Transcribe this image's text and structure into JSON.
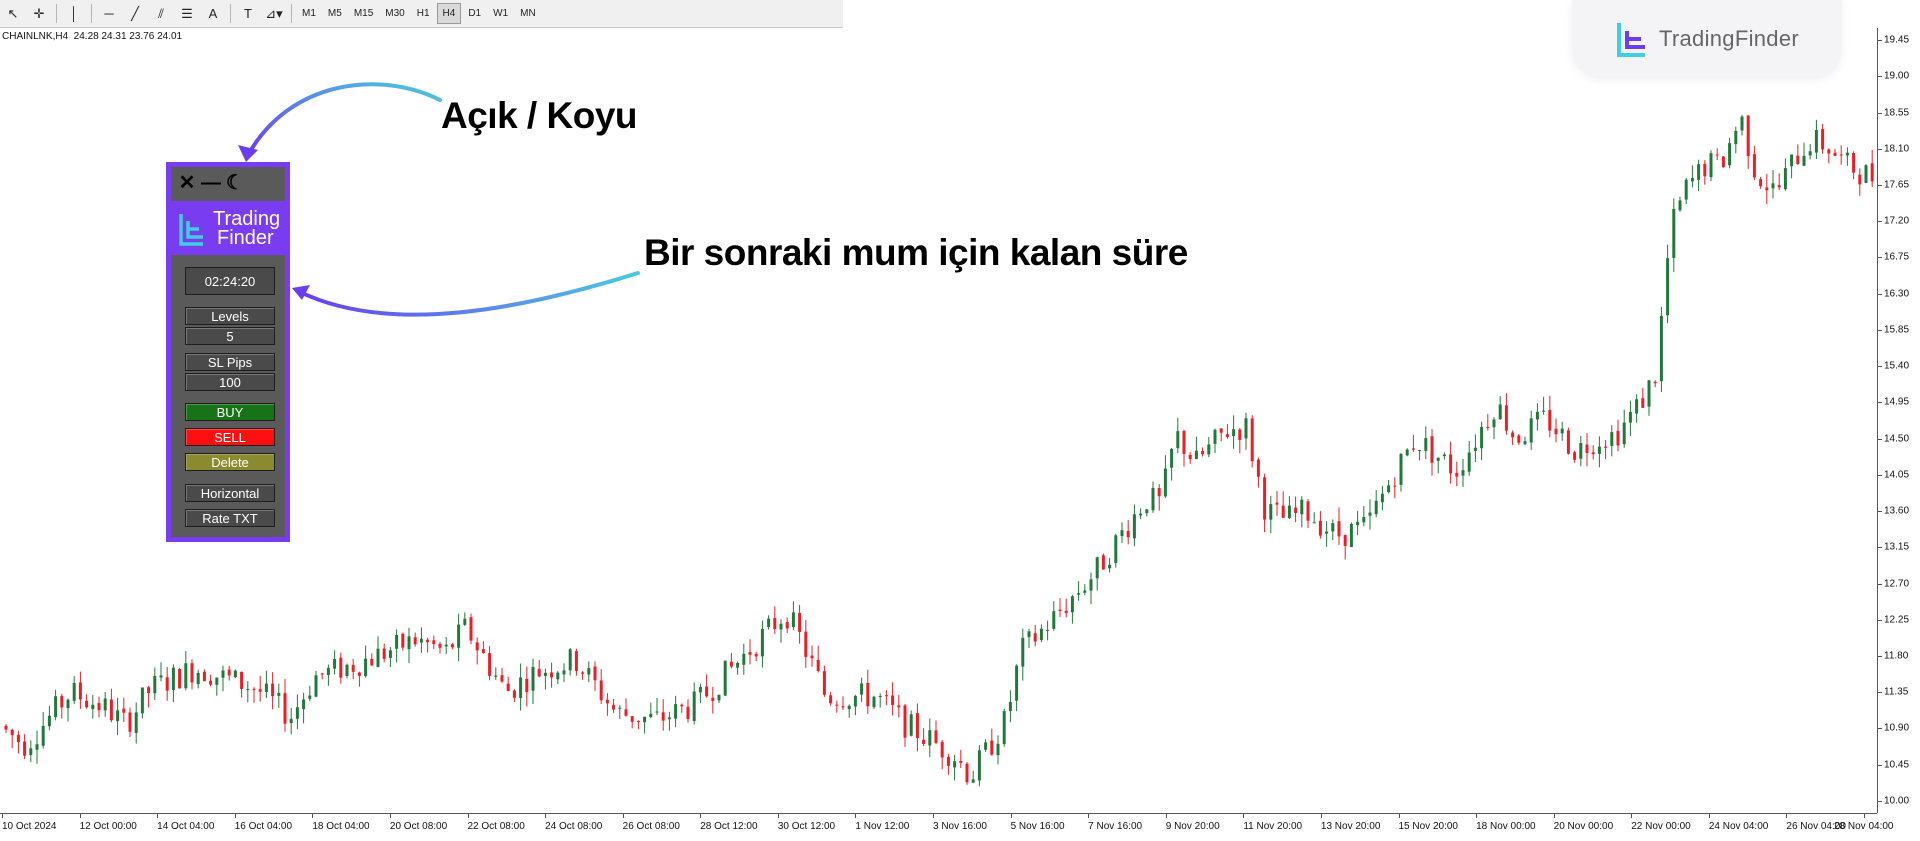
{
  "toolbar": {
    "tools": [
      {
        "name": "cursor-icon",
        "glyph": "↖"
      },
      {
        "name": "crosshair-icon",
        "glyph": "✛"
      },
      {
        "name": "vertical-line-icon",
        "glyph": "│"
      },
      {
        "name": "horizontal-line-icon",
        "glyph": "─"
      },
      {
        "name": "trendline-icon",
        "glyph": "╱"
      },
      {
        "name": "channel-icon",
        "glyph": "⫽"
      },
      {
        "name": "fibonacci-icon",
        "glyph": "☰"
      },
      {
        "name": "text-icon",
        "glyph": "A"
      },
      {
        "name": "text-label-icon",
        "glyph": "T"
      },
      {
        "name": "shapes-icon",
        "glyph": "⊿▾"
      }
    ],
    "timeframes": [
      "M1",
      "M5",
      "M15",
      "M30",
      "H1",
      "H4",
      "D1",
      "W1",
      "MN"
    ],
    "active_timeframe": "H4"
  },
  "symbol_info": "CHAINLNK,H4  24.28 24.31 23.76 24.01",
  "logo": {
    "text": "TradingFinder"
  },
  "panel": {
    "logo_line1": "Trading",
    "logo_line2": "Finder",
    "timer": "02:24:20",
    "levels_label": "Levels",
    "levels_value": "5",
    "sl_label": "SL Pips",
    "sl_value": "100",
    "buy_label": "BUY",
    "sell_label": "SELL",
    "delete_label": "Delete",
    "horizontal_label": "Horizontal",
    "rate_label": "Rate TXT"
  },
  "annotations": {
    "light_dark": "Açık / Koyu",
    "remaining_time": "Bir sonraki mum için kalan süre"
  },
  "colors": {
    "bull": "#1f7a3a",
    "bear": "#ee1c24",
    "panel_border": "#7a3cf0",
    "arrow_start": "#4cc9e0",
    "arrow_end": "#6a3df0"
  },
  "chart_data": {
    "type": "candlestick",
    "timeframe": "H4",
    "price_range": [
      9.85,
      19.6
    ],
    "price_ticks": [
      "19.45",
      "19.00",
      "18.55",
      "18.10",
      "17.65",
      "17.20",
      "16.75",
      "16.30",
      "15.85",
      "15.40",
      "14.95",
      "14.50",
      "14.05",
      "13.60",
      "13.15",
      "12.70",
      "12.25",
      "11.80",
      "11.35",
      "10.90",
      "10.45",
      "10.00"
    ],
    "time_labels": [
      "10 Oct 2024",
      "12 Oct 00:00",
      "14 Oct 04:00",
      "16 Oct 04:00",
      "18 Oct 04:00",
      "20 Oct 08:00",
      "22 Oct 08:00",
      "24 Oct 08:00",
      "26 Oct 08:00",
      "28 Oct 12:00",
      "30 Oct 12:00",
      "1 Nov 12:00",
      "3 Nov 16:00",
      "5 Nov 16:00",
      "7 Nov 16:00",
      "9 Nov 20:00",
      "11 Nov 20:00",
      "13 Nov 20:00",
      "15 Nov 20:00",
      "18 Nov 00:00",
      "20 Nov 00:00",
      "22 Nov 00:00",
      "24 Nov 04:00",
      "26 Nov 04:00",
      "28 Nov 04:00"
    ],
    "price_path": [
      [
        0,
        10.95
      ],
      [
        30,
        10.7
      ],
      [
        75,
        11.35
      ],
      [
        110,
        11.15
      ],
      [
        130,
        10.95
      ],
      [
        155,
        11.4
      ],
      [
        200,
        11.65
      ],
      [
        260,
        11.4
      ],
      [
        295,
        11.05
      ],
      [
        320,
        11.55
      ],
      [
        360,
        11.7
      ],
      [
        420,
        12.0
      ],
      [
        450,
        11.85
      ],
      [
        470,
        12.15
      ],
      [
        510,
        11.35
      ],
      [
        540,
        11.6
      ],
      [
        580,
        11.75
      ],
      [
        620,
        11.1
      ],
      [
        660,
        11.0
      ],
      [
        700,
        11.2
      ],
      [
        740,
        11.7
      ],
      [
        790,
        12.35
      ],
      [
        805,
        12.0
      ],
      [
        830,
        11.3
      ],
      [
        880,
        11.3
      ],
      [
        910,
        10.95
      ],
      [
        960,
        10.55
      ],
      [
        975,
        10.3
      ],
      [
        990,
        10.6
      ],
      [
        1010,
        11.0
      ],
      [
        1025,
        11.85
      ],
      [
        1060,
        12.3
      ],
      [
        1100,
        12.85
      ],
      [
        1150,
        13.75
      ],
      [
        1165,
        13.7
      ],
      [
        1180,
        14.55
      ],
      [
        1200,
        14.2
      ],
      [
        1230,
        14.6
      ],
      [
        1250,
        14.65
      ],
      [
        1270,
        13.6
      ],
      [
        1290,
        13.5
      ],
      [
        1310,
        13.6
      ],
      [
        1340,
        13.3
      ],
      [
        1370,
        13.4
      ],
      [
        1400,
        14.1
      ],
      [
        1420,
        14.5
      ],
      [
        1440,
        14.3
      ],
      [
        1460,
        14.1
      ],
      [
        1480,
        14.5
      ],
      [
        1500,
        14.95
      ],
      [
        1520,
        14.5
      ],
      [
        1550,
        14.75
      ],
      [
        1580,
        14.35
      ],
      [
        1600,
        14.5
      ],
      [
        1620,
        14.55
      ],
      [
        1645,
        14.95
      ],
      [
        1660,
        15.3
      ],
      [
        1675,
        17.1
      ],
      [
        1690,
        17.6
      ],
      [
        1710,
        17.9
      ],
      [
        1725,
        17.9
      ],
      [
        1745,
        18.5
      ],
      [
        1760,
        17.8
      ],
      [
        1780,
        17.55
      ],
      [
        1800,
        18.0
      ],
      [
        1815,
        18.2
      ],
      [
        1830,
        18.15
      ],
      [
        1850,
        17.9
      ],
      [
        1877,
        17.75
      ]
    ]
  }
}
